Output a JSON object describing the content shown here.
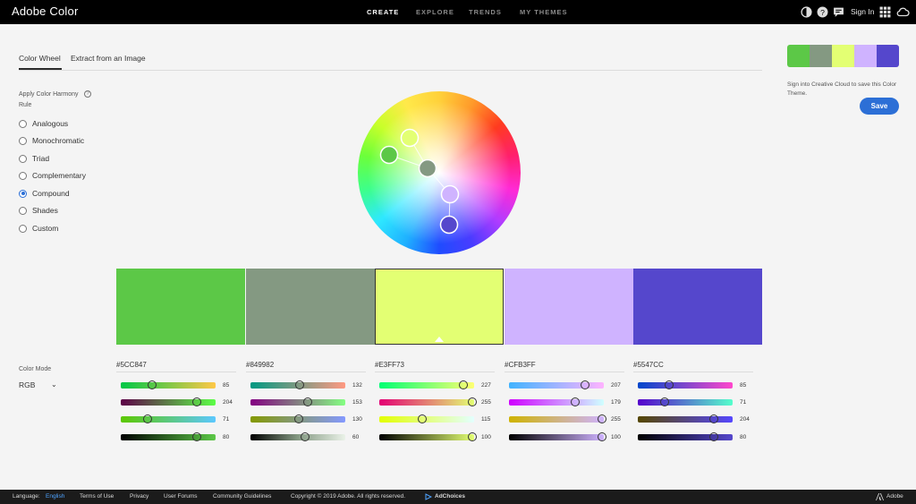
{
  "header": {
    "app_title": "Adobe Color",
    "nav": [
      {
        "label": "CREATE",
        "active": true
      },
      {
        "label": "EXPLORE",
        "active": false
      },
      {
        "label": "TRENDS",
        "active": false
      },
      {
        "label": "MY THEMES",
        "active": false
      }
    ],
    "icons": [
      "contrast-icon",
      "help-icon",
      "feedback-icon",
      "apps-grid-icon",
      "creative-cloud-icon"
    ],
    "sign_in": "Sign In"
  },
  "tabs": [
    {
      "label": "Color Wheel",
      "active": true
    },
    {
      "label": "Extract from an Image",
      "active": false
    }
  ],
  "harmony": {
    "title": "Apply Color Harmony Rule",
    "help_glyph": "?",
    "rules": [
      {
        "label": "Analogous",
        "selected": false
      },
      {
        "label": "Monochromatic",
        "selected": false
      },
      {
        "label": "Triad",
        "selected": false
      },
      {
        "label": "Complementary",
        "selected": false
      },
      {
        "label": "Compound",
        "selected": true
      },
      {
        "label": "Shades",
        "selected": false
      },
      {
        "label": "Custom",
        "selected": false
      }
    ]
  },
  "swatches": [
    "#5CC847",
    "#849982",
    "#E3FF73",
    "#CFB3FF",
    "#5547CC"
  ],
  "selected_swatch": 2,
  "color_mode": {
    "label": "Color Mode",
    "value": "RGB",
    "chevron": "⌄"
  },
  "columns": [
    {
      "hex": "#5CC847",
      "values": [
        "85",
        "204",
        "71",
        "80"
      ]
    },
    {
      "hex": "#849982",
      "values": [
        "132",
        "153",
        "130",
        "60"
      ]
    },
    {
      "hex": "#E3FF73",
      "values": [
        "227",
        "255",
        "115",
        "100"
      ]
    },
    {
      "hex": "#CFB3FF",
      "values": [
        "207",
        "179",
        "255",
        "100"
      ]
    },
    {
      "hex": "#5547CC",
      "values": [
        "85",
        "71",
        "204",
        "80"
      ]
    }
  ],
  "save_panel": {
    "hint": "Sign into Creative Cloud to save this Color Theme.",
    "save_label": "Save"
  },
  "footer": {
    "language_label": "Language:",
    "language_value": "English",
    "links": [
      "Terms of Use",
      "Privacy",
      "User Forums",
      "Community Guidelines"
    ],
    "copyright": "Copyright © 2019 Adobe. All rights reserved.",
    "adchoices": "AdChoices",
    "brand": "Adobe"
  }
}
